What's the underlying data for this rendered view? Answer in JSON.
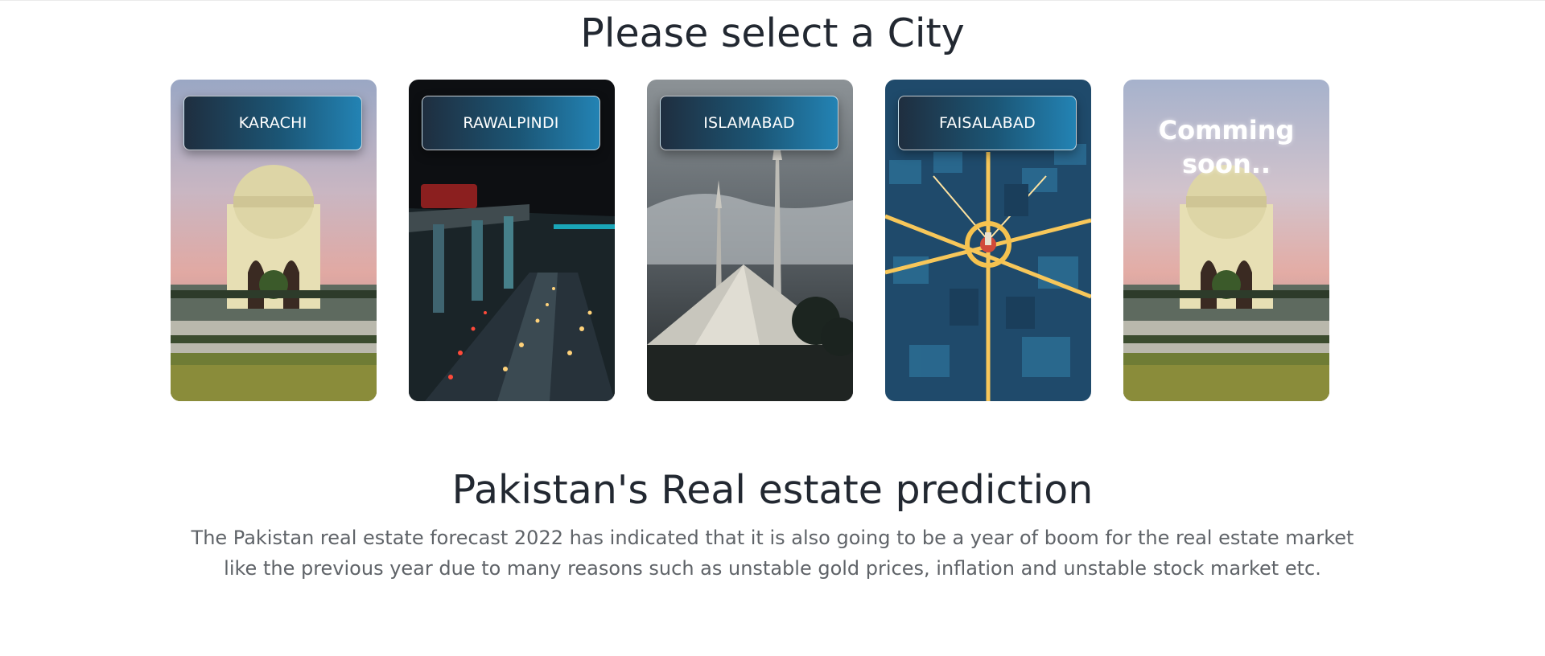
{
  "header": {
    "title": "Please select a City"
  },
  "cities": [
    {
      "label": "KARACHI",
      "image_icon": "mazar-e-quaid-icon"
    },
    {
      "label": "RAWALPINDI",
      "image_icon": "night-highway-icon"
    },
    {
      "label": "ISLAMABAD",
      "image_icon": "faisal-mosque-icon"
    },
    {
      "label": "FAISALABAD",
      "image_icon": "clock-tower-aerial-icon"
    }
  ],
  "coming_soon": {
    "text": "Comming soon..",
    "image_icon": "mazar-e-quaid-icon"
  },
  "section": {
    "title": "Pakistan's Real estate prediction",
    "description": "The Pakistan real estate forecast 2022 has indicated that it is also going to be a year of boom for the real estate market like the previous year due to many reasons such as unstable gold prices, inflation and unstable stock market etc."
  },
  "colors": {
    "button_gradient_start": "#1f2e3f",
    "button_gradient_end": "#2383b4",
    "heading": "#222831",
    "body_text": "#5f6368"
  }
}
